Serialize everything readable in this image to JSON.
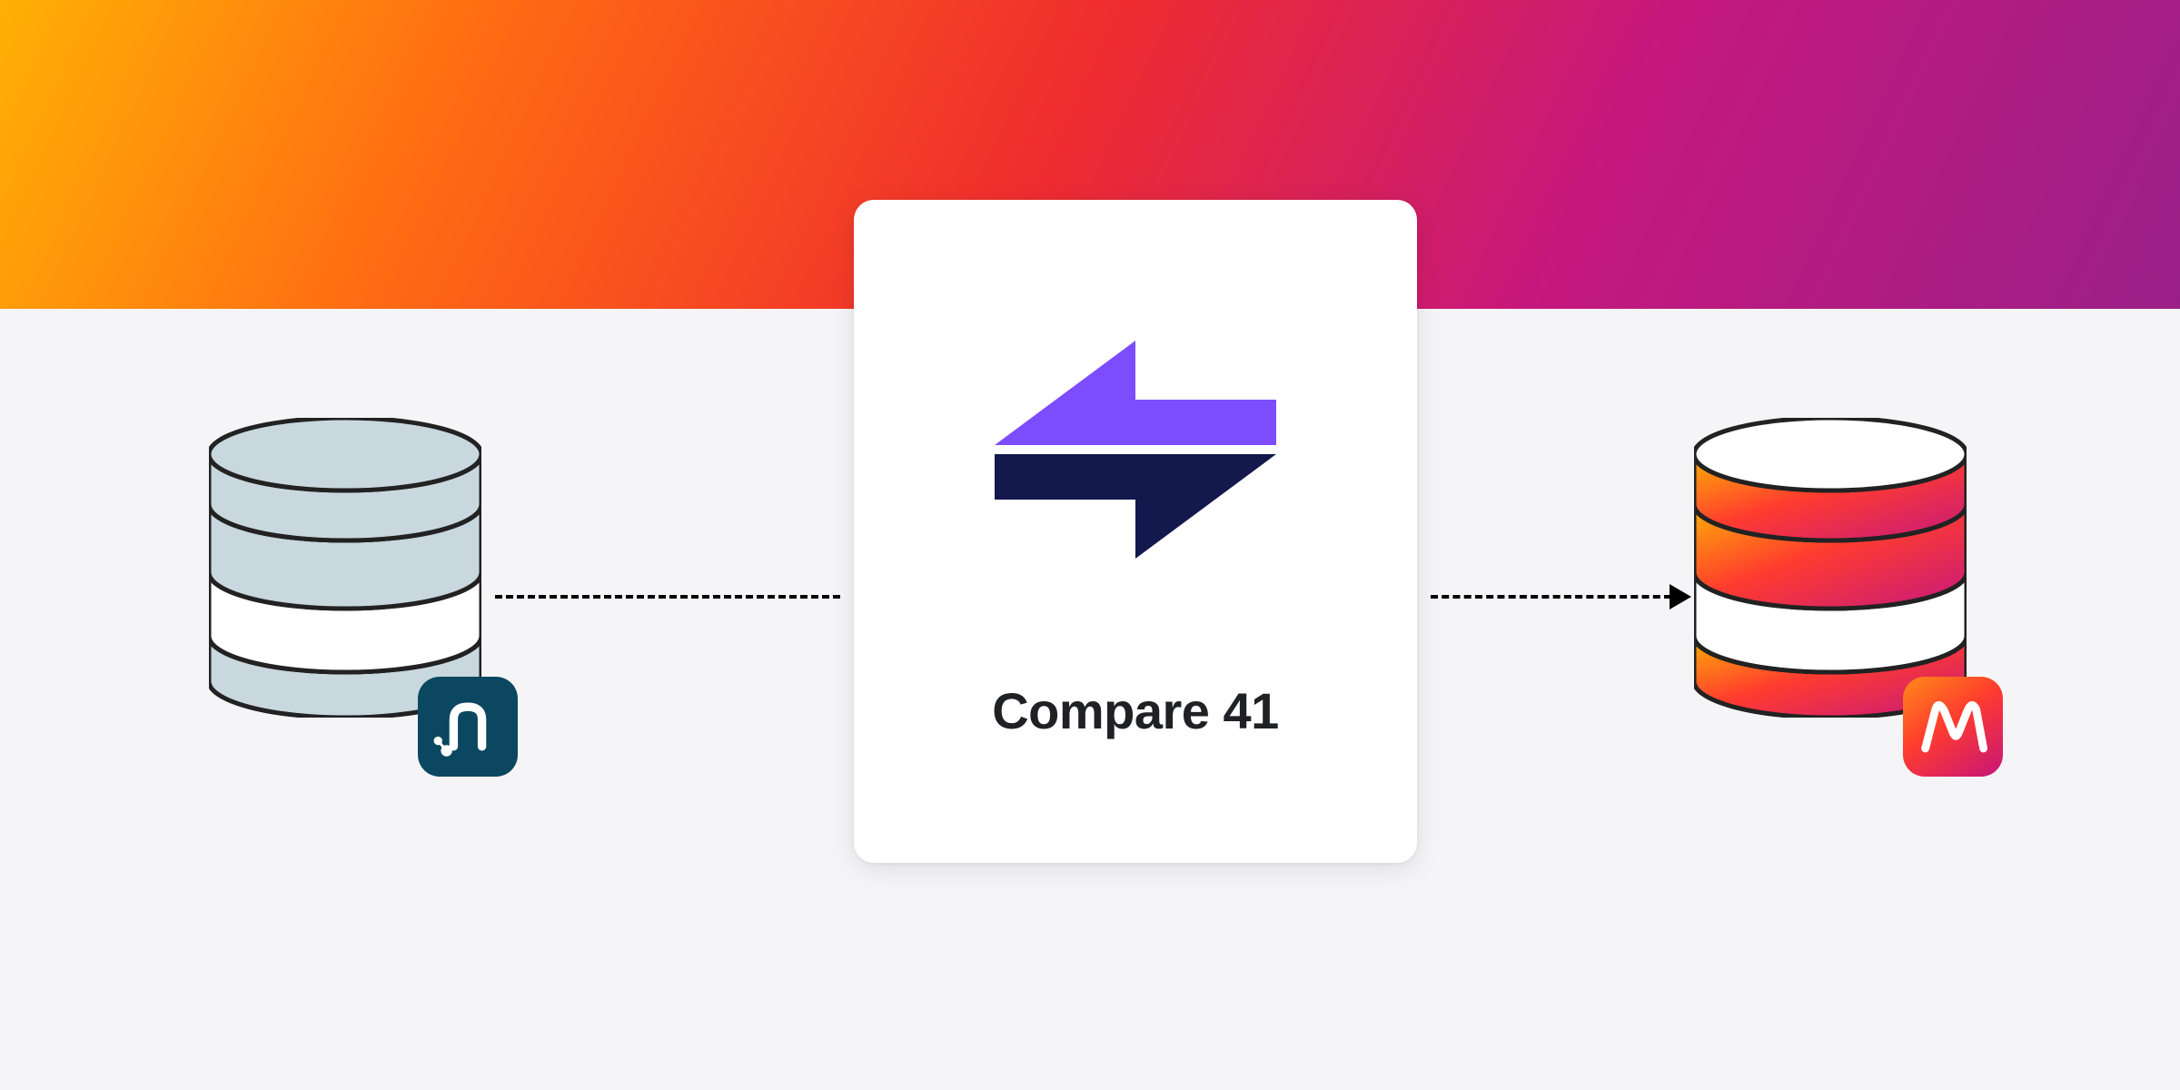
{
  "card": {
    "title": "Compare 41",
    "logo_top_color": "#7c4dff",
    "logo_bottom_color": "#13184d"
  },
  "left_db": {
    "fill": "#c9d7de",
    "stroke": "#222",
    "badge_icon_name": "neo4j-icon"
  },
  "right_db": {
    "gradient_from": "#ffb005",
    "gradient_to": "#c6187d",
    "stroke": "#222",
    "badge_icon_name": "memgraph-icon"
  },
  "colors": {
    "header_gradient": [
      "#ffb005",
      "#ff6a13",
      "#ef2d2e",
      "#c6187d",
      "#9a2088"
    ],
    "page_bg": "#f5f5f7"
  }
}
